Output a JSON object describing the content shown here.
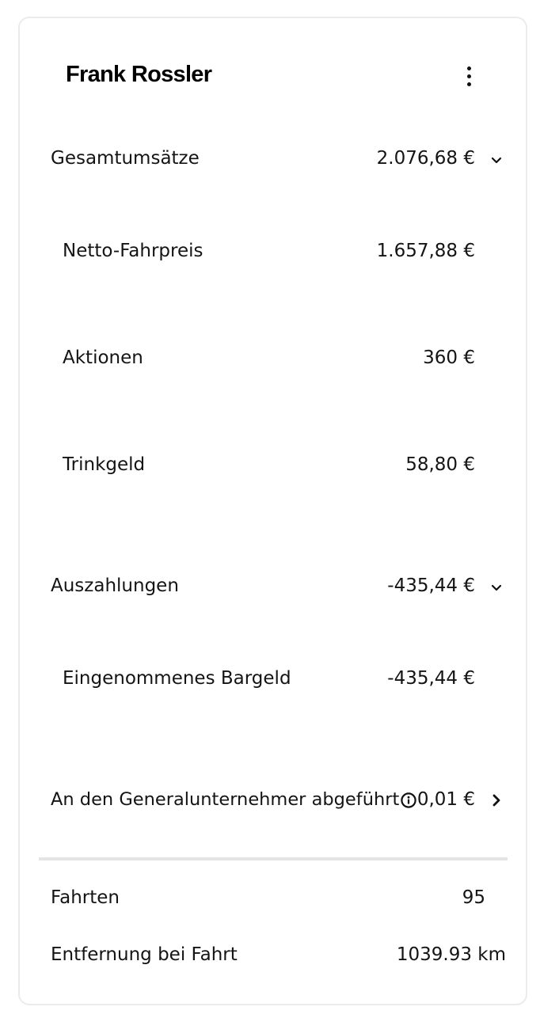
{
  "header": {
    "title": "Frank Rossler",
    "menu_icon": "more-vertical-icon"
  },
  "revenue": {
    "label": "Gesamtumsätze",
    "value": "2.076,68 €",
    "items": [
      {
        "label": "Netto-Fahrpreis",
        "value": "1.657,88 €"
      },
      {
        "label": "Aktionen",
        "value": "360 €"
      },
      {
        "label": "Trinkgeld",
        "value": "58,80 €"
      }
    ]
  },
  "payouts": {
    "label": "Auszahlungen",
    "value": "-435,44 €",
    "items": [
      {
        "label": "Eingenommenes Bargeld",
        "value": "-435,44 €"
      }
    ]
  },
  "contractor": {
    "label": "An den Generalunternehmer abgeführt",
    "value": "0,01 €",
    "info_icon": "info-icon",
    "arrow_icon": "chevron-right-icon"
  },
  "stats": [
    {
      "label": "Fahrten",
      "value": "95"
    },
    {
      "label": "Entfernung bei Fahrt",
      "value": "1039.93 km"
    }
  ]
}
